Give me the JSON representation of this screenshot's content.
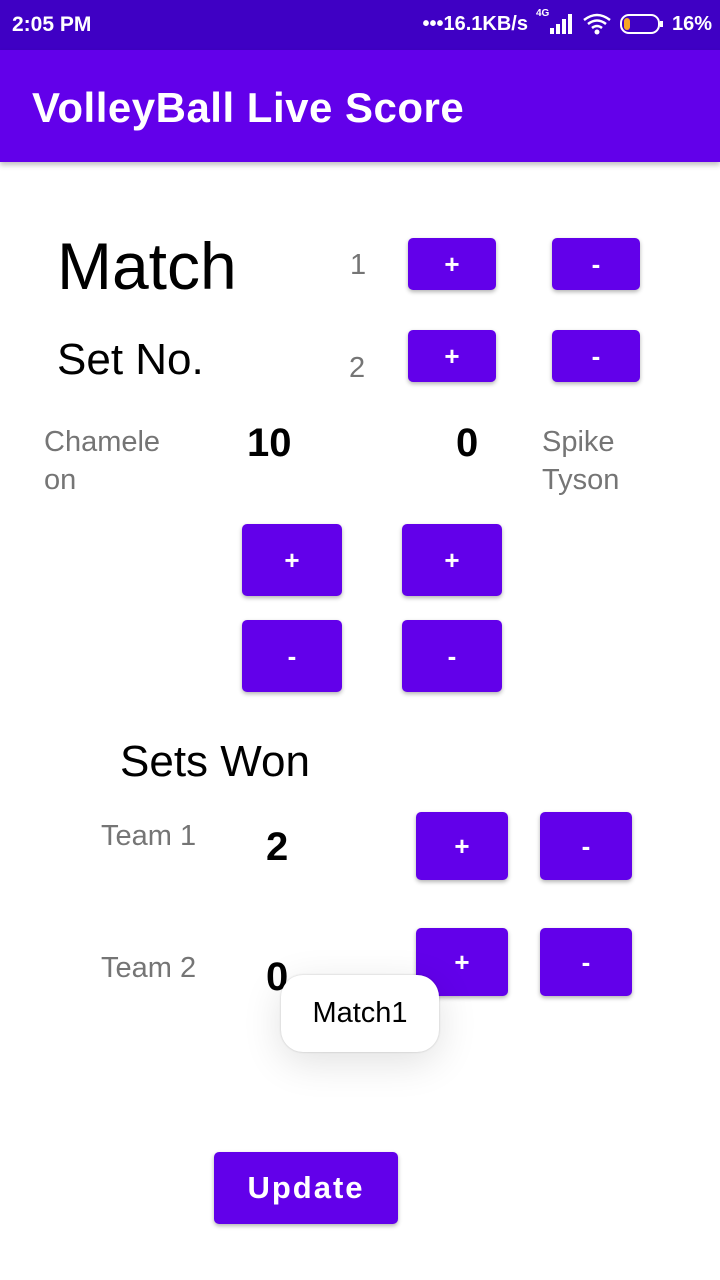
{
  "status_bar": {
    "time": "2:05 PM",
    "net_speed": "•••16.1KB/s",
    "network": "4G",
    "battery": "16%",
    "icons": [
      "signal-icon",
      "wifi-icon",
      "battery-icon"
    ]
  },
  "app_bar": {
    "title": "VolleyBall Live Score"
  },
  "match": {
    "label": "Match",
    "value": "1",
    "plus": "+",
    "minus": "-"
  },
  "set": {
    "label": "Set No.",
    "value": "2",
    "plus": "+",
    "minus": "-"
  },
  "score": {
    "team_a_name": "Chameleon",
    "team_a_line1": "Chamele",
    "team_a_line2": "on",
    "team_a_score": "10",
    "team_b_score": "0",
    "team_b_line1": "Spike",
    "team_b_line2": "Tyson",
    "plus": "+",
    "minus": "-"
  },
  "sets_won": {
    "heading": "Sets Won",
    "team1_label": "Team 1",
    "team1_value": "2",
    "team2_label": "Team 2",
    "team2_value": "0",
    "plus": "+",
    "minus": "-"
  },
  "toast": "Match1",
  "update_button": "Update",
  "colors": {
    "primary": "#6200ea",
    "status_bar": "#3f00c4",
    "label_grey": "#757575"
  }
}
